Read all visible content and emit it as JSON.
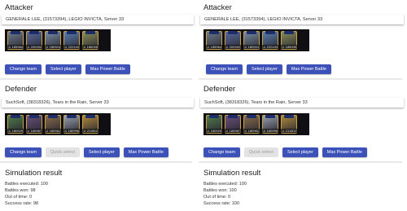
{
  "left": {
    "attacker": {
      "title": "Attacker",
      "info": "GENERALE LEE, (31573394), LEGIO INVICTA, Server 33",
      "heroes": [
        {
          "power": "⚔ 185964",
          "color": "#6f7b8a"
        },
        {
          "power": "⚔ 200392",
          "color": "#5a6b9e"
        },
        {
          "power": "⚔ 180924",
          "color": "#7a8fa4"
        },
        {
          "power": "⚔ 222100",
          "color": "#5b7fb0"
        },
        {
          "power": "⚔ 186005",
          "color": "#8a8f5a"
        }
      ],
      "buttons": {
        "change_team": "Change team",
        "select_player": "Select player",
        "max_power": "Max Power Battle"
      }
    },
    "defender": {
      "title": "Defender",
      "info": "SuchSoft, (38318326), Tears in the Rain, Server 33",
      "heroes": [
        {
          "power": "⚔ 180929",
          "color": "#4f7b4a"
        },
        {
          "power": "⚔ 180987",
          "color": "#6b4f7b"
        },
        {
          "power": "⚔ 180961",
          "color": "#8a6b4a"
        },
        {
          "power": "⚔ 180996",
          "color": "#9aa0b0"
        },
        {
          "power": "⚔ 211602",
          "color": "#b08a3a"
        }
      ],
      "buttons": {
        "change_team": "Change team",
        "quick_select": "Quick select",
        "select_player": "Select player",
        "max_power": "Max Power Battle"
      }
    },
    "result": {
      "title": "Simulation result",
      "lines": [
        "Battles executed: 100",
        "Battles won: 98",
        "Out of time: 0",
        "Success rate: 98"
      ]
    }
  },
  "right": {
    "attacker": {
      "title": "Attacker",
      "info": "GENERALE LEE, (31573394), LEGIO INVICTA, Server 33",
      "heroes": [
        {
          "power": "⚔ 185964",
          "color": "#6f7b8a"
        },
        {
          "power": "⚔ 200392",
          "color": "#5a6b9e"
        },
        {
          "power": "⚔ 180924",
          "color": "#7a8fa4"
        },
        {
          "power": "⚔ 222100",
          "color": "#5b7fb0"
        },
        {
          "power": "⚔ 186005",
          "color": "#8a8f5a"
        }
      ],
      "buttons": {
        "change_team": "Change team",
        "select_player": "Select player",
        "max_power": "Max Power Battle"
      }
    },
    "defender": {
      "title": "Defender",
      "info": "SuchSoft, (38318326), Tears in the Rain, Server 33",
      "heroes": [
        {
          "power": "⚔ 180929",
          "color": "#4f7b4a"
        },
        {
          "power": "⚔ 180987",
          "color": "#6b4f7b"
        },
        {
          "power": "⚔ 180961",
          "color": "#8a6b4a"
        },
        {
          "power": "⚔ 180996",
          "color": "#9aa0b0"
        },
        {
          "power": "⚔ 211602",
          "color": "#b08a3a"
        }
      ],
      "buttons": {
        "change_team": "Change team",
        "quick_select": "Quick select",
        "select_player": "Select player",
        "max_power": "Max Power Battle"
      }
    },
    "result": {
      "title": "Simulation result",
      "lines": [
        "Battles executed: 100",
        "Battles won: 100",
        "Out of time: 0",
        "Success rate: 100"
      ]
    }
  },
  "colors": {
    "primary_button": "#3d52b8",
    "disabled_button": "#e3e3e3",
    "team_strip": "#101014",
    "hero_frame": "#c7a24a"
  }
}
